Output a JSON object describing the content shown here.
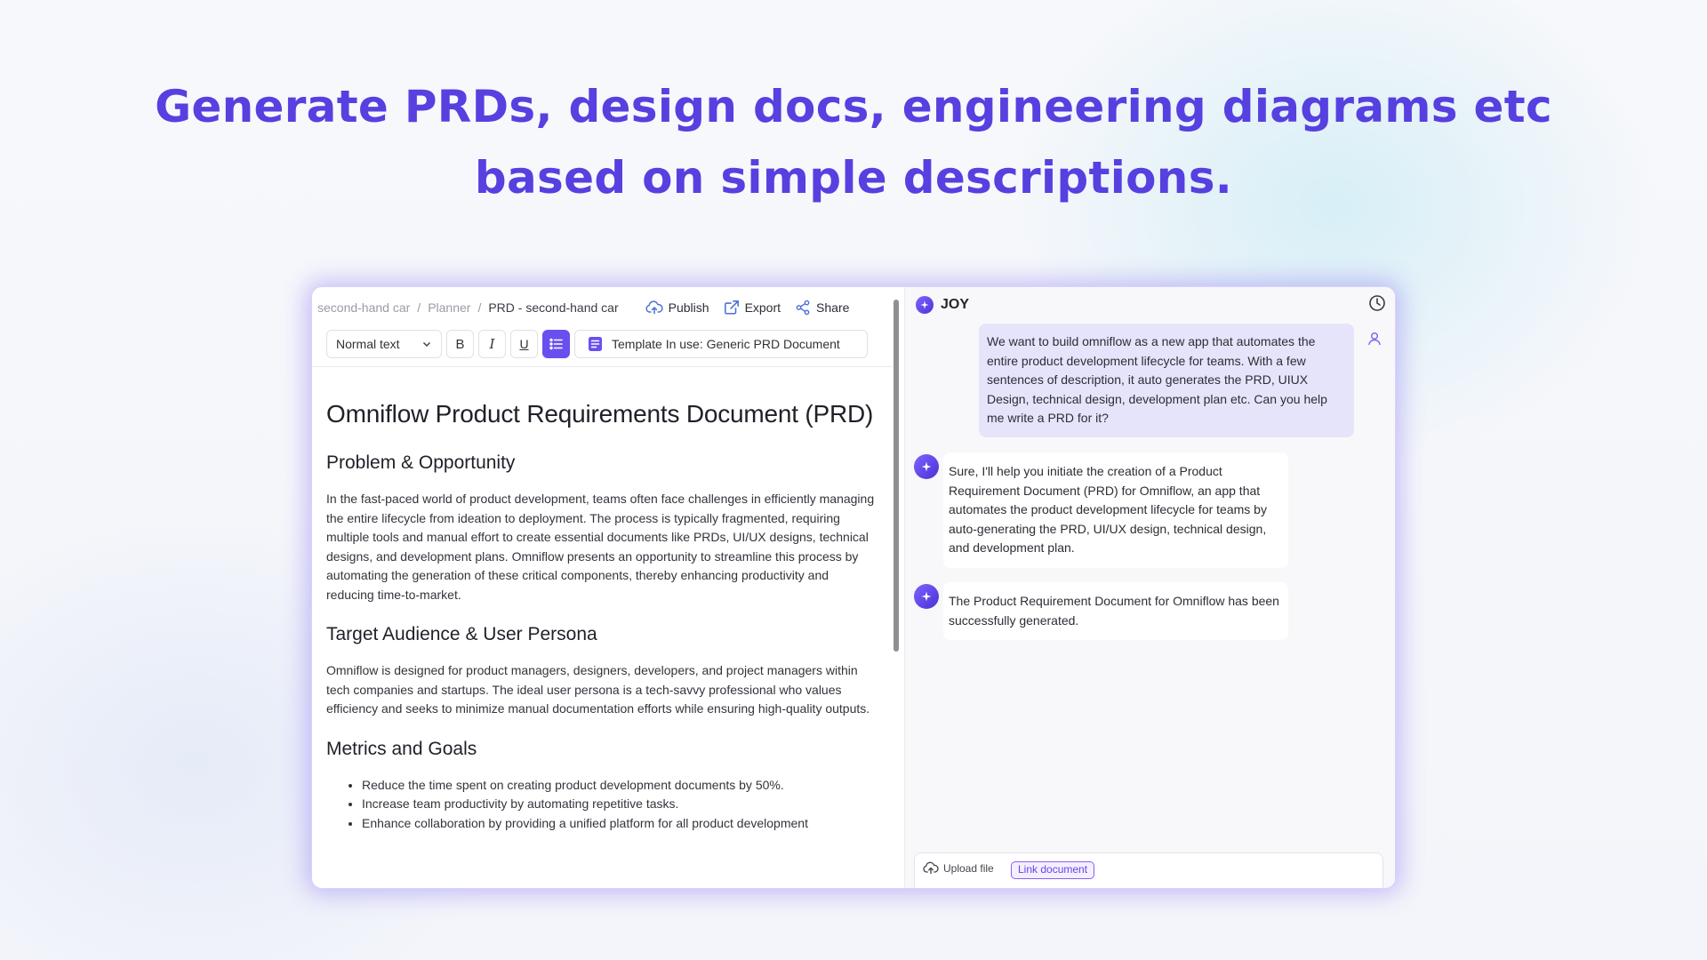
{
  "headline": {
    "line1": "Generate PRDs, design docs, engineering diagrams etc",
    "line2": "based on simple descriptions."
  },
  "colors": {
    "accent": "#5640e0",
    "button_active": "#6a4ff0",
    "user_bubble": "#e6e4fb"
  },
  "editor": {
    "breadcrumb": [
      "second-hand car",
      "Planner",
      "PRD - second-hand car"
    ],
    "breadcrumb_separator": "/",
    "actions": [
      {
        "label": "Publish",
        "icon": "cloud-upload-icon"
      },
      {
        "label": "Export",
        "icon": "export-icon"
      },
      {
        "label": "Share",
        "icon": "share-icon"
      }
    ],
    "toolbar": {
      "text_style": "Normal text",
      "bold": "B",
      "italic": "I",
      "underline": "U",
      "template_label": "Template In use: Generic PRD Document"
    },
    "document": {
      "title": "Omniflow Product Requirements Document (PRD)",
      "sections": [
        {
          "heading": "Problem & Opportunity",
          "body": "In the fast-paced world of product development, teams often face challenges in efficiently managing the entire lifecycle from ideation to deployment. The process is typically fragmented, requiring multiple tools and manual effort to create essential documents like PRDs, UI/UX designs, technical designs, and development plans. Omniflow presents an opportunity to streamline this process by automating the generation of these critical components, thereby enhancing productivity and reducing time-to-market."
        },
        {
          "heading": "Target Audience & User Persona",
          "body": "Omniflow is designed for product managers, designers, developers, and project managers within tech companies and startups. The ideal user persona is a tech-savvy professional who values efficiency and seeks to minimize manual documentation efforts while ensuring high-quality outputs."
        },
        {
          "heading": "Metrics and Goals",
          "bullets": [
            "Reduce the time spent on creating product development documents by 50%.",
            "Increase team productivity by automating repetitive tasks.",
            "Enhance collaboration by providing a unified platform for all product development"
          ]
        }
      ]
    }
  },
  "chat": {
    "title": "JOY",
    "user_message": "We want to build omniflow as a new app that automates the entire product development lifecycle for teams. With a few sentences of description, it auto generates the PRD, UIUX Design, technical design, development plan etc. Can you help me write a PRD for it?",
    "bot_messages": [
      "Sure, I'll help you initiate the creation of a Product Requirement Document (PRD) for Omniflow, an app that automates the product development lifecycle for teams by auto-generating the PRD, UI/UX design, technical design, and development plan.",
      "The Product Requirement Document for Omniflow has been successfully generated."
    ],
    "composer": {
      "upload_label": "Upload file",
      "link_label": "Link document"
    }
  }
}
